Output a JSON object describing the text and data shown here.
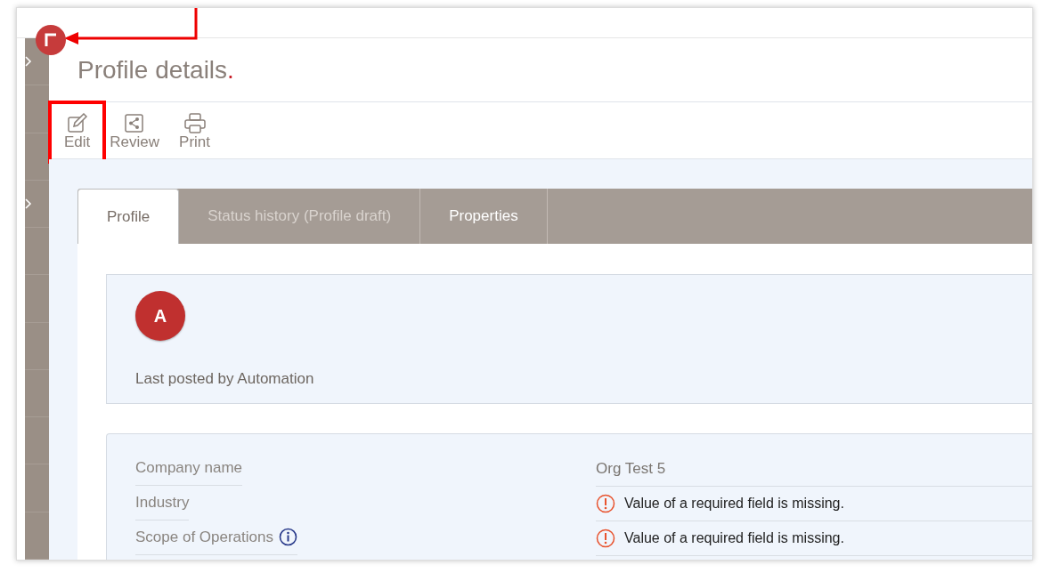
{
  "page": {
    "title": "Profile details",
    "title_mark": "."
  },
  "toolbar": [
    {
      "label": "Edit",
      "kind": "edit",
      "highlighted": true
    },
    {
      "label": "Review",
      "kind": "share",
      "highlighted": false
    },
    {
      "label": "Print",
      "kind": "print",
      "highlighted": false
    }
  ],
  "tabs": [
    {
      "label": "Profile",
      "selected": true,
      "disabled": false
    },
    {
      "label": "Status history (Profile draft)",
      "selected": false,
      "disabled": true
    },
    {
      "label": "Properties",
      "selected": false,
      "disabled": false
    }
  ],
  "post": {
    "avatar": "A",
    "caption": "Last posted by Automation"
  },
  "fields": [
    {
      "label": "Company name",
      "kind": "text",
      "value": "Org Test 5",
      "info": false
    },
    {
      "label": "Industry",
      "kind": "error",
      "value": "Value of a required field is missing.",
      "info": false
    },
    {
      "label": "Scope of Operations",
      "kind": "error",
      "value": "Value of a required field is missing.",
      "info": true
    }
  ]
}
